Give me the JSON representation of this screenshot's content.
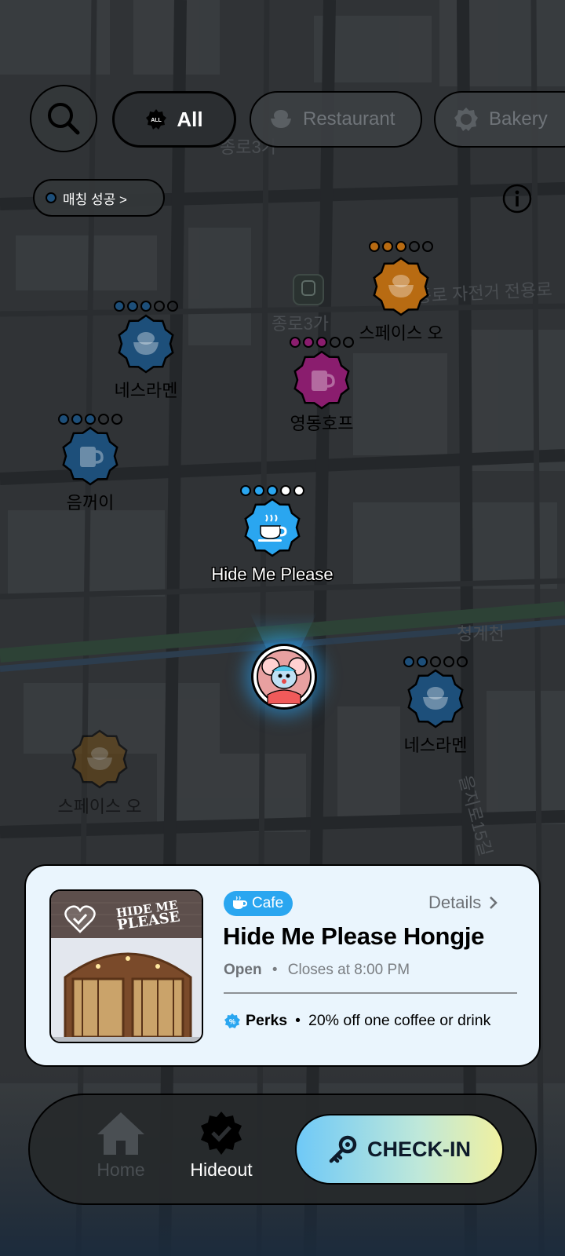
{
  "filters": {
    "search_icon": "search-icon",
    "chips": [
      {
        "id": "all",
        "label": "All",
        "icon": "all-badge-icon",
        "active": true
      },
      {
        "id": "restaurant",
        "label": "Restaurant",
        "icon": "rice-bowl-icon",
        "active": false
      },
      {
        "id": "bakery",
        "label": "Bakery",
        "icon": "bakery-icon",
        "active": false
      }
    ]
  },
  "match_filter": {
    "label": "매칭 성공 >"
  },
  "map": {
    "street_labels": [
      "종로3가",
      "종로3가",
      "종로 자전거 전용로",
      "청계천",
      "을지로15길"
    ],
    "places": [
      {
        "name": "네스라멘",
        "category": "restaurant",
        "color": "#1d4f7a",
        "filled_dots": 3
      },
      {
        "name": "스페이스 오",
        "category": "restaurant",
        "color": "#b86b12",
        "filled_dots": 3
      },
      {
        "name": "영동호프",
        "category": "pub",
        "color": "#8a1d6e",
        "filled_dots": 3
      },
      {
        "name": "음꺼이",
        "category": "pub",
        "color": "#1d4f7a",
        "filled_dots": 3
      },
      {
        "name": "Hide Me Please",
        "category": "cafe",
        "color": "#2aa6f0",
        "filled_dots": 3
      },
      {
        "name": "네스라멘",
        "category": "restaurant",
        "color": "#1d4f7a",
        "filled_dots": 2
      },
      {
        "name": "스페이스 오",
        "category": "restaurant",
        "color": "#6e4a12",
        "filled_dots": 0
      }
    ]
  },
  "place_card": {
    "category": "Cafe",
    "details_label": "Details",
    "name": "Hide Me Please Hongje",
    "status": "Open",
    "hours": "Closes at 8:00 PM",
    "separator": "•",
    "perks_label": "Perks",
    "perks_text": "20% off one coffee or drink",
    "photo_brand_line1": "HIDE ME",
    "photo_brand_line2": "PLEASE"
  },
  "bottom_nav": {
    "home_label": "Home",
    "hideout_label": "Hideout",
    "checkin_label": "CHECK-IN"
  },
  "colors": {
    "accent": "#2aa6f0",
    "card_bg": "#eaf5fd",
    "map_bg": "#2f3234"
  }
}
